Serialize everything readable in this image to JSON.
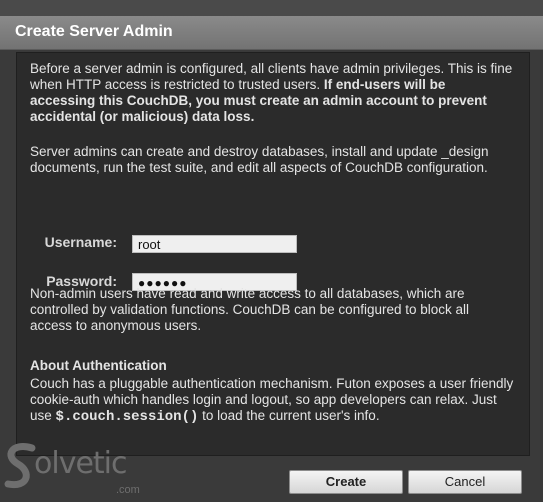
{
  "dialog": {
    "title": "Create Server Admin",
    "intro_normal": "Before a server admin is configured, all clients have admin privileges. This is fine when HTTP access is restricted to trusted users.",
    "intro_bold": "If end-users will be accessing this CouchDB, you must create an admin account to prevent accidental (or malicious) data loss.",
    "server_admins_text": "Server admins can create and destroy databases, install and update _design documents, run the test suite, and edit all aspects of CouchDB configuration.",
    "username_label": "Username:",
    "username_value": "root",
    "password_label": "Password:",
    "password_value": "●●●●●●",
    "non_admin_text": "Non-admin users have read and write access to all databases, which are controlled by validation functions. CouchDB can be configured to block all access to anonymous users.",
    "about_heading": "About Authentication",
    "about_text_pre": "Couch has a pluggable authentication mechanism. Futon exposes a user friendly cookie-auth which handles login and logout, so app developers can relax. Just use",
    "about_code": "$.couch.session()",
    "about_text_post": "to load the current user's info.",
    "create_button": "Create",
    "cancel_button": "Cancel"
  },
  "watermark": {
    "logo_text": "olvetic",
    "domain": ".com"
  }
}
